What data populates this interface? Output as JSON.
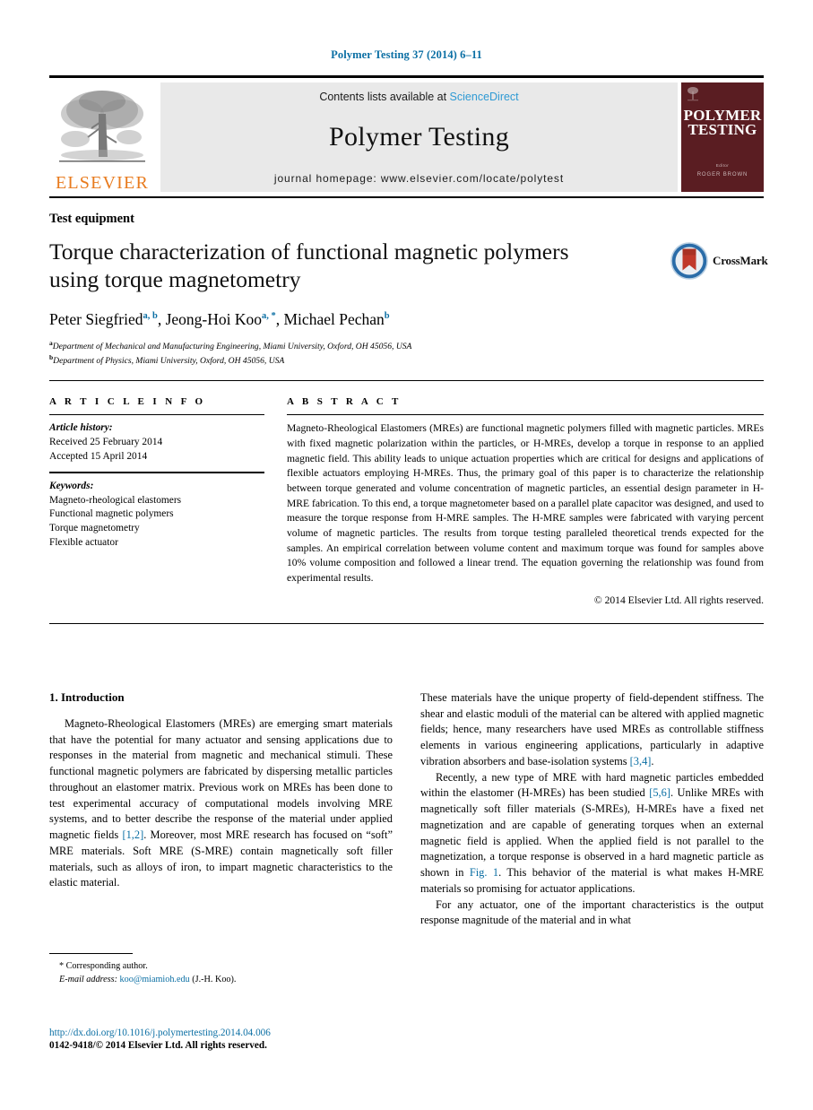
{
  "running_head": "Polymer Testing 37 (2014) 6–11",
  "masthead": {
    "publisher_wordmark": "ELSEVIER",
    "contents_prefix": "Contents lists available at ",
    "contents_link": "ScienceDirect",
    "journal_title": "Polymer Testing",
    "homepage": "journal homepage: www.elsevier.com/locate/polytest",
    "cover": {
      "title_line1": "POLYMER",
      "title_line2": "TESTING",
      "editor_label": "Editor",
      "editor_name": "ROGER BROWN"
    }
  },
  "article": {
    "section_type": "Test equipment",
    "title": "Torque characterization of functional magnetic polymers using torque magnetometry",
    "authors": [
      {
        "name": "Peter Siegfried",
        "marks": "a, b"
      },
      {
        "name": "Jeong-Hoi Koo",
        "marks": "a, *"
      },
      {
        "name": "Michael Pechan",
        "marks": "b"
      }
    ],
    "affiliations": [
      {
        "mark": "a",
        "text": "Department of Mechanical and Manufacturing Engineering, Miami University, Oxford, OH 45056, USA"
      },
      {
        "mark": "b",
        "text": "Department of Physics, Miami University, Oxford, OH 45056, USA"
      }
    ],
    "crossmark_label": "CrossMark"
  },
  "info": {
    "heading": "A R T I C L E    I N F O",
    "history_label": "Article history:",
    "history": [
      "Received 25 February 2014",
      "Accepted 15 April 2014"
    ],
    "keywords_label": "Keywords:",
    "keywords": [
      "Magneto-rheological elastomers",
      "Functional magnetic polymers",
      "Torque magnetometry",
      "Flexible actuator"
    ]
  },
  "abstract": {
    "heading": "A B S T R A C T",
    "text": "Magneto-Rheological Elastomers (MREs) are functional magnetic polymers filled with magnetic particles. MREs with fixed magnetic polarization within the particles, or H-MREs, develop a torque in response to an applied magnetic field. This ability leads to unique actuation properties which are critical for designs and applications of flexible actuators employing H-MREs. Thus, the primary goal of this paper is to characterize the relationship between torque generated and volume concentration of magnetic particles, an essential design parameter in H-MRE fabrication. To this end, a torque magnetometer based on a parallel plate capacitor was designed, and used to measure the torque response from H-MRE samples. The H-MRE samples were fabricated with varying percent volume of magnetic particles. The results from torque testing paralleled theoretical trends expected for the samples. An empirical correlation between volume content and maximum torque was found for samples above 10% volume composition and followed a linear trend. The equation governing the relationship was found from experimental results.",
    "copyright": "© 2014 Elsevier Ltd. All rights reserved."
  },
  "body": {
    "section_heading": "1. Introduction",
    "left_paragraphs": [
      {
        "seg1": "Magneto-Rheological Elastomers (MREs) are emerging smart materials that have the potential for many actuator and sensing applications due to responses in the material from magnetic and mechanical stimuli. These functional magnetic polymers are fabricated by dispersing metallic particles throughout an elastomer matrix. Previous work on MREs has been done to test experimental accuracy of computational models involving MRE systems, and to better describe the response of the material under applied magnetic fields ",
        "cite": "[1,2]",
        "seg2": ". Moreover, most MRE research has focused on “soft” MRE materials. Soft MRE (S-MRE) contain magnetically soft filler materials, such as alloys of iron, to impart magnetic characteristics to the elastic material."
      }
    ],
    "right_paragraphs": [
      {
        "seg1": "These materials have the unique property of field-dependent stiffness. The shear and elastic moduli of the material can be altered with applied magnetic fields; hence, many researchers have used MREs as controllable stiffness elements in various engineering applications, particularly in adaptive vibration absorbers and base-isolation systems ",
        "cite": "[3,4]",
        "seg2": "."
      },
      {
        "seg1": "Recently, a new type of MRE with hard magnetic particles embedded within the elastomer (H-MREs) has been studied ",
        "cite": "[5,6]",
        "seg2": ". Unlike MREs with magnetically soft filler materials (S-MREs), H-MREs have a fixed net magnetization and are capable of generating torques when an external magnetic field is applied. When the applied field is not parallel to the magnetization, a torque response is observed in a hard magnetic particle as shown in ",
        "cite2": "Fig. 1",
        "seg3": ". This behavior of the material is what makes H-MRE materials so promising for actuator applications."
      },
      {
        "seg1": "For any actuator, one of the important characteristics is the output response magnitude of the material and in what"
      }
    ]
  },
  "footnote": {
    "corresponding": "* Corresponding author.",
    "email_label": "E-mail address:",
    "email": "koo@miamioh.edu",
    "email_suffix": "(J.-H. Koo)."
  },
  "doc_footer": {
    "doi": "http://dx.doi.org/10.1016/j.polymertesting.2014.04.006",
    "issn_line": "0142-9418/© 2014 Elsevier Ltd. All rights reserved."
  },
  "colors": {
    "link_blue": "#0b6fa4",
    "sciencedirect_blue": "#2f9ad4",
    "elsevier_orange": "#E87B1E",
    "cover_maroon": "#5a1d22"
  }
}
